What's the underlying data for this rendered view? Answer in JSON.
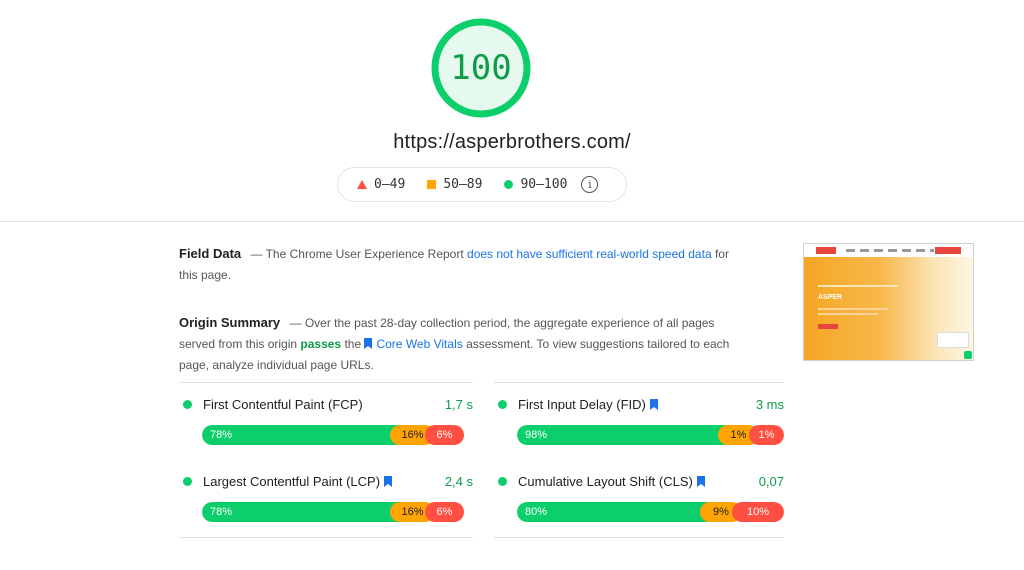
{
  "score": {
    "value": "100",
    "color": "#0cce6b",
    "fill": "#e6f9ef"
  },
  "url": "https://asperbrothers.com/",
  "legend": [
    {
      "icon": "triangle-icon",
      "range": "0–49",
      "color": "#ff4e42"
    },
    {
      "icon": "square-icon",
      "range": "50–89",
      "color": "#ffa400"
    },
    {
      "icon": "circle-icon",
      "range": "90–100",
      "color": "#0cce6b"
    }
  ],
  "field_data": {
    "title": "Field Data",
    "text_before": "— The Chrome User Experience Report",
    "link": "does not have sufficient real-world speed data",
    "text_after": "for this page."
  },
  "origin_summary": {
    "title": "Origin Summary",
    "text_before": "— Over the past 28-day collection period, the aggregate experience of all pages served from this origin",
    "passes": "passes",
    "text_the": "the",
    "link": "Core Web Vitals",
    "text_after": "assessment. To view suggestions tailored to each page, analyze individual page URLs."
  },
  "thumbnail": {
    "title": "ASPER"
  },
  "metrics": [
    {
      "name": "First Contentful Paint (FCP)",
      "value": "1,7 s",
      "core": false,
      "good": "78%",
      "avg": "16%",
      "poor": "6%"
    },
    {
      "name": "First Input Delay (FID)",
      "value": "3 ms",
      "core": true,
      "good": "98%",
      "avg": "1%",
      "poor": "1%"
    },
    {
      "name": "Largest Contentful Paint (LCP)",
      "value": "2,4 s",
      "core": true,
      "good": "78%",
      "avg": "16%",
      "poor": "6%"
    },
    {
      "name": "Cumulative Layout Shift (CLS)",
      "value": "0,07",
      "core": true,
      "good": "80%",
      "avg": "9%",
      "poor": "10%"
    }
  ]
}
